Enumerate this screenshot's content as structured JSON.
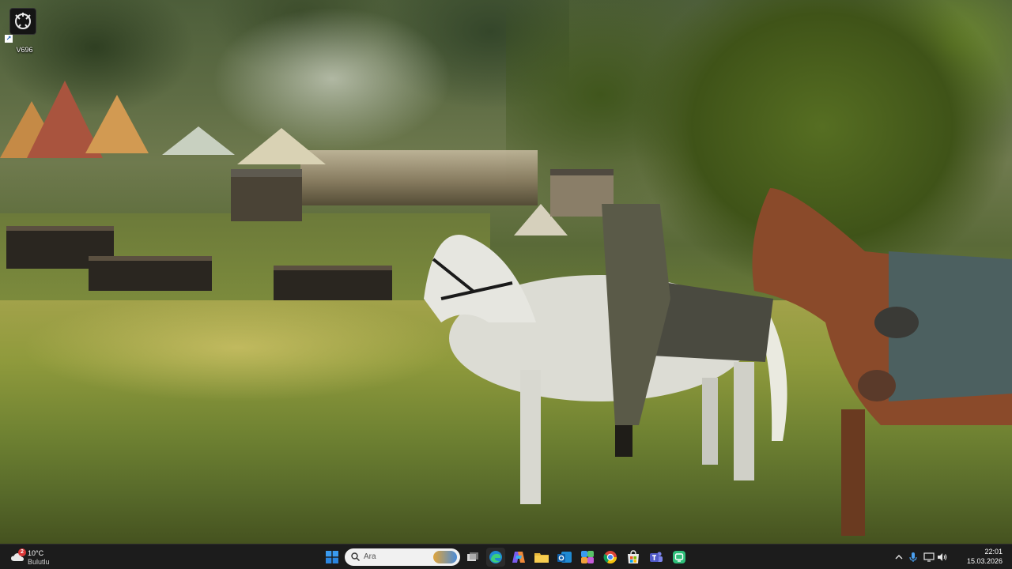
{
  "desktop": {
    "icons": [
      {
        "label": "V696",
        "icon": "app-icon"
      }
    ]
  },
  "taskbar": {
    "weather": {
      "temperature": "10°C",
      "condition": "Bulutlu",
      "badge": "2",
      "icon": "cloud-icon"
    },
    "search": {
      "placeholder": "Ara"
    },
    "pinned_apps": [
      {
        "name": "start",
        "icon": "windows-start-icon"
      },
      {
        "name": "task-view",
        "icon": "task-view-icon"
      },
      {
        "name": "edge",
        "icon": "edge-browser-icon"
      },
      {
        "name": "copilot",
        "icon": "copilot-icon"
      },
      {
        "name": "file-explorer",
        "icon": "folder-icon"
      },
      {
        "name": "outlook",
        "icon": "outlook-icon"
      },
      {
        "name": "copilot-365",
        "icon": "m365-copilot-icon"
      },
      {
        "name": "chrome",
        "icon": "chrome-icon"
      },
      {
        "name": "store",
        "icon": "store-icon"
      },
      {
        "name": "teams",
        "icon": "teams-icon"
      },
      {
        "name": "app",
        "icon": "app-green-icon"
      }
    ],
    "tray": {
      "icons": [
        "chevron-up-icon",
        "microphone-icon",
        "display-icon",
        "volume-icon"
      ],
      "time": "22:01",
      "date": "15.03.2026"
    },
    "colors": {
      "bar": "#1c1c1c",
      "accent": "#0078d4"
    }
  }
}
